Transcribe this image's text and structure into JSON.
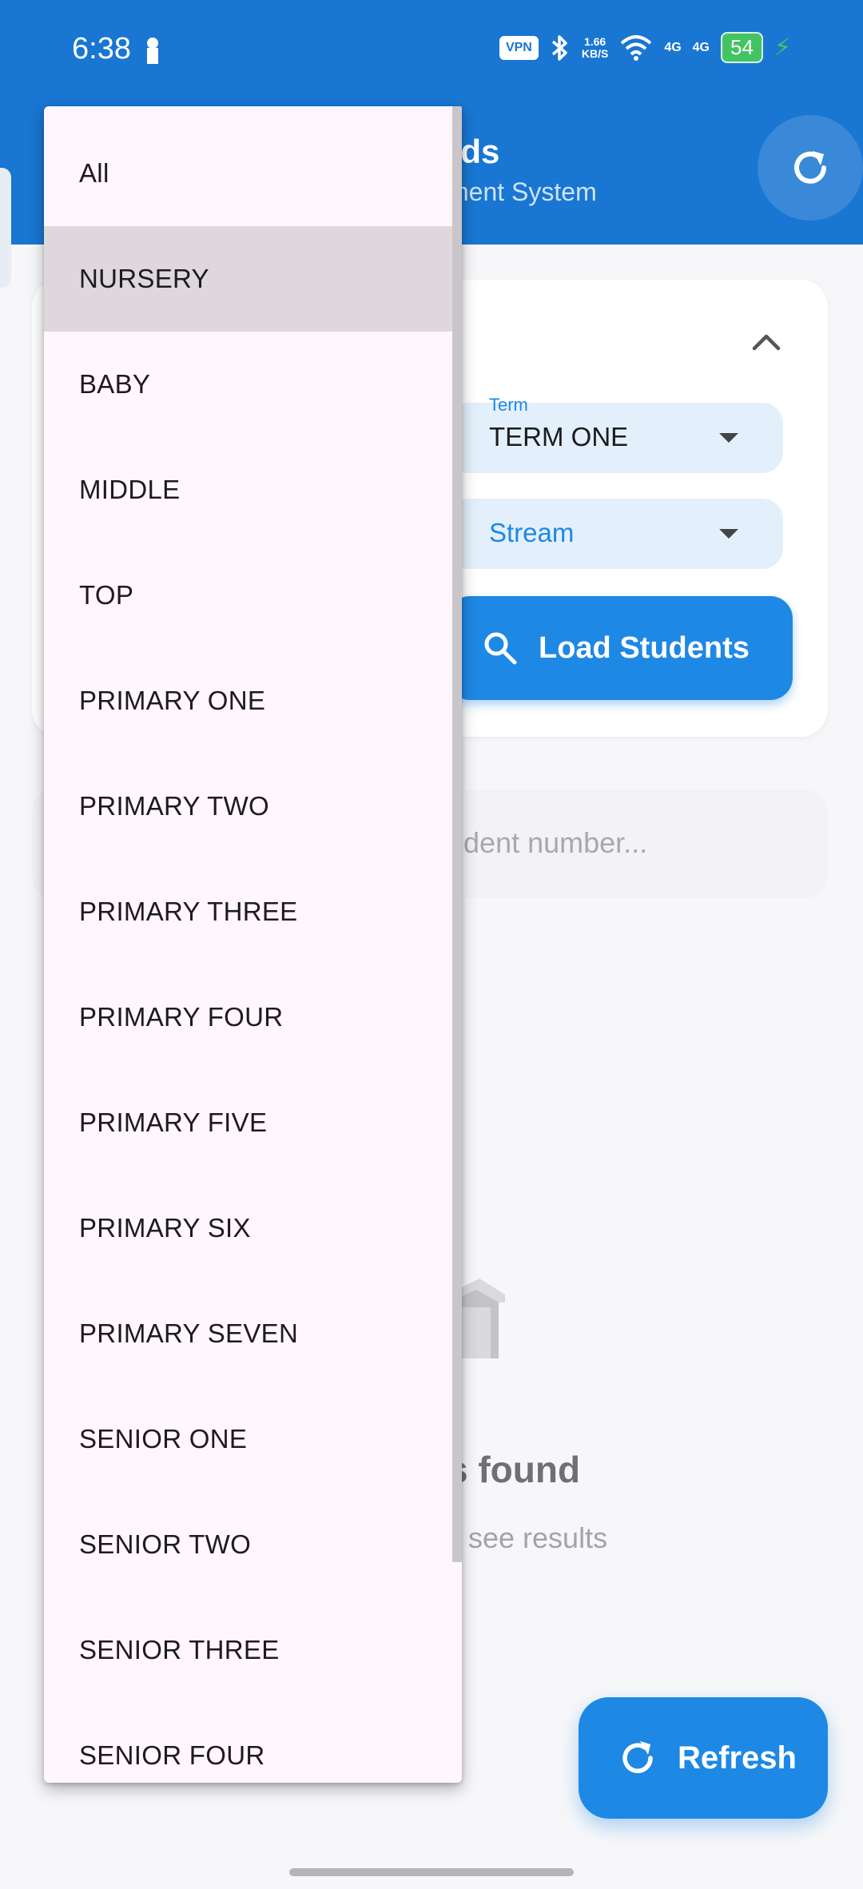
{
  "status_bar": {
    "time": "6:38",
    "vpn": "VPN",
    "speed_top": "1.66",
    "speed_bottom": "KB/S",
    "signal1": "4G",
    "signal2": "4G",
    "battery": "54"
  },
  "app_bar": {
    "title_partial": "rds",
    "subtitle_partial": "ment System"
  },
  "filters": {
    "term_label": "Term",
    "term_value": "TERM ONE",
    "stream_placeholder": "Stream",
    "load_button": "Load Students"
  },
  "search": {
    "placeholder_partial": "udent number..."
  },
  "empty_state": {
    "title_partial": "s found",
    "subtitle_partial": "see results"
  },
  "fab": {
    "label": "Refresh"
  },
  "class_dropdown": {
    "selected": "NURSERY",
    "items": [
      "All",
      "NURSERY",
      "BABY",
      "MIDDLE",
      "TOP",
      "PRIMARY ONE",
      "PRIMARY TWO",
      "PRIMARY THREE",
      "PRIMARY FOUR",
      "PRIMARY FIVE",
      "PRIMARY SIX",
      "PRIMARY SEVEN",
      "SENIOR ONE",
      "SENIOR TWO",
      "SENIOR THREE",
      "SENIOR FOUR"
    ]
  },
  "colors": {
    "primary": "#1976d2",
    "accent": "#1e88e5",
    "menu_bg": "#fff7fd",
    "menu_selected": "#ded8dd"
  }
}
